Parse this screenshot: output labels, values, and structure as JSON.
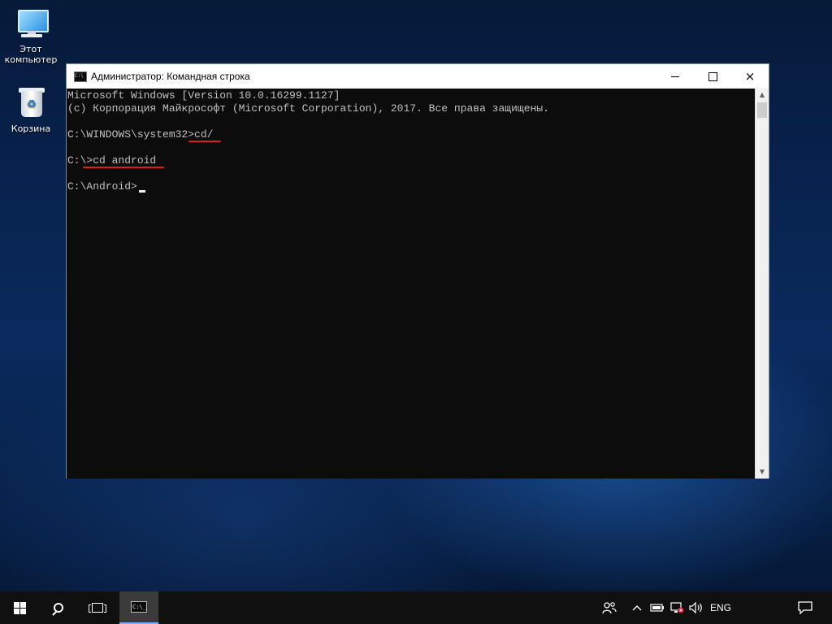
{
  "desktop": {
    "icons": [
      {
        "label_line1": "Этот",
        "label_line2": "компьютер",
        "icon": "this-pc-icon"
      },
      {
        "label_line1": "Корзина",
        "icon": "recycle-bin-icon"
      }
    ]
  },
  "window": {
    "title": "Администратор: Командная строка",
    "icon": "cmd-icon",
    "controls": {
      "minimize": "minimize-icon",
      "maximize": "maximize-icon",
      "close": "×"
    }
  },
  "console": {
    "lines": [
      "Microsoft Windows [Version 10.0.16299.1127]",
      "(c) Корпорация Майкрософт (Microsoft Corporation), 2017. Все права защищены.",
      "C:\\WINDOWS\\system32>cd/",
      "C:\\>cd android",
      "C:\\Android>"
    ],
    "annotation_color": "#e01b1b"
  },
  "taskbar": {
    "start": "windows-logo-icon",
    "search": "search-icon",
    "task_view": "task-view-icon",
    "tray": {
      "language": "ENG",
      "chevron": "^"
    }
  }
}
